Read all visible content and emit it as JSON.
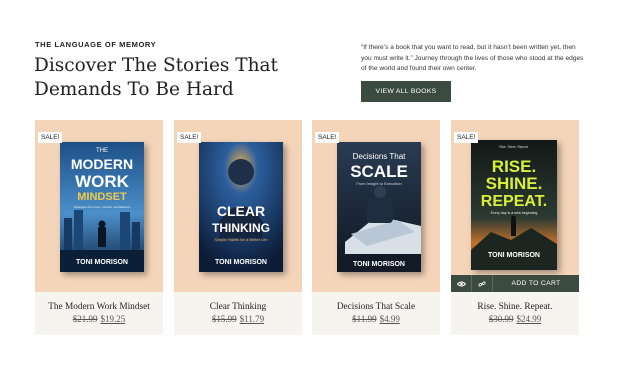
{
  "header": {
    "eyebrow": "THE LANGUAGE OF MEMORY",
    "headline_line1": "Discover The Stories That",
    "headline_line2": "Demands To Be Hard",
    "quote": "“If there’s a book that you want to read, but it hasn’t been written yet, then you must write it.” Journey through the lives of those who stood at the edges of the world and found their own center.",
    "cta_label": "VIEW ALL BOOKS"
  },
  "products": [
    {
      "badge": "SALE!",
      "title": "The Modern Work Mindset",
      "price_old": "$21.99",
      "price_new": "$19.25",
      "cover": {
        "line1": "THE",
        "line2": "MODERN",
        "line3": "WORK",
        "line4": "MINDSET",
        "tagline": "Strategies for Focus, Growth, and Balance",
        "author": "TONI MORISON",
        "bg": "#1d4f86",
        "accent": "#f2c94c"
      }
    },
    {
      "badge": "SALE!",
      "title": "Clear Thinking",
      "price_old": "$15.99",
      "price_new": "$11.79",
      "cover": {
        "line1": "CLEAR",
        "line2": "THINKING",
        "tagline": "Simple Habits for a Better Life",
        "author": "TONI MORISON",
        "bg": "#13294d",
        "accent": "#f4b24a"
      }
    },
    {
      "badge": "SALE!",
      "title": "Decisions That Scale",
      "price_old": "$11.99",
      "price_new": "$4.99",
      "cover": {
        "line1": "Decisions That",
        "line2": "SCALE",
        "tagline": "From Insight to Execution",
        "author": "TONI MORISON",
        "bg": "#1b2a3c",
        "accent": "#ffffff"
      }
    },
    {
      "badge": "SALE!",
      "title": "Rise. Shine. Repeat.",
      "price_old": "$30.99",
      "price_new": "$24.99",
      "cover": {
        "line0": "Rise. Shine. Repeat.",
        "line1": "RISE.",
        "line2": "SHINE.",
        "line3": "REPEAT.",
        "tagline": "Every day is a new beginning",
        "author": "TONI MORISON",
        "bg": "#1a2220",
        "accent": "#d7ef3a"
      },
      "hover": {
        "view_icon": "eye-icon",
        "link_icon": "link-icon",
        "add_label": "ADD TO CART"
      }
    }
  ]
}
